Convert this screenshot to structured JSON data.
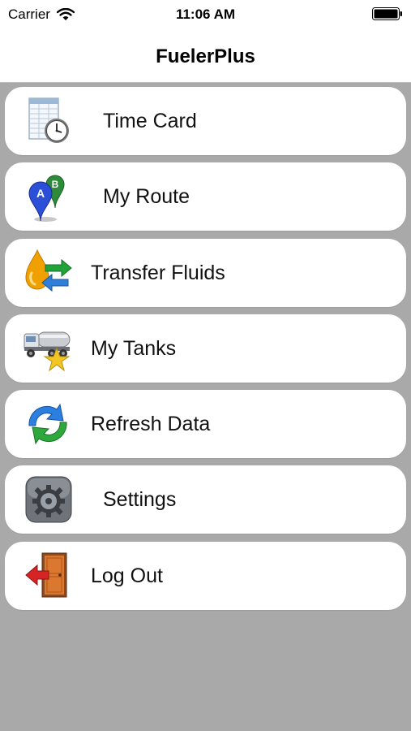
{
  "status_bar": {
    "carrier": "Carrier",
    "time": "11:06 AM",
    "wifi_icon": "wifi-icon",
    "battery_icon": "battery-icon"
  },
  "nav": {
    "title": "FuelerPlus"
  },
  "menu": {
    "items": [
      {
        "label": "Time Card",
        "icon": "timecard-clock-icon"
      },
      {
        "label": "My Route",
        "icon": "route-pins-icon"
      },
      {
        "label": "Transfer Fluids",
        "icon": "fluid-transfer-icon"
      },
      {
        "label": "My Tanks",
        "icon": "tanker-truck-star-icon"
      },
      {
        "label": "Refresh Data",
        "icon": "refresh-icon"
      },
      {
        "label": "Settings",
        "icon": "settings-gear-icon"
      },
      {
        "label": "Log Out",
        "icon": "logout-door-icon"
      }
    ]
  },
  "colors": {
    "background": "#a9a9a9",
    "card": "#ffffff",
    "bar": "#ffffff"
  }
}
